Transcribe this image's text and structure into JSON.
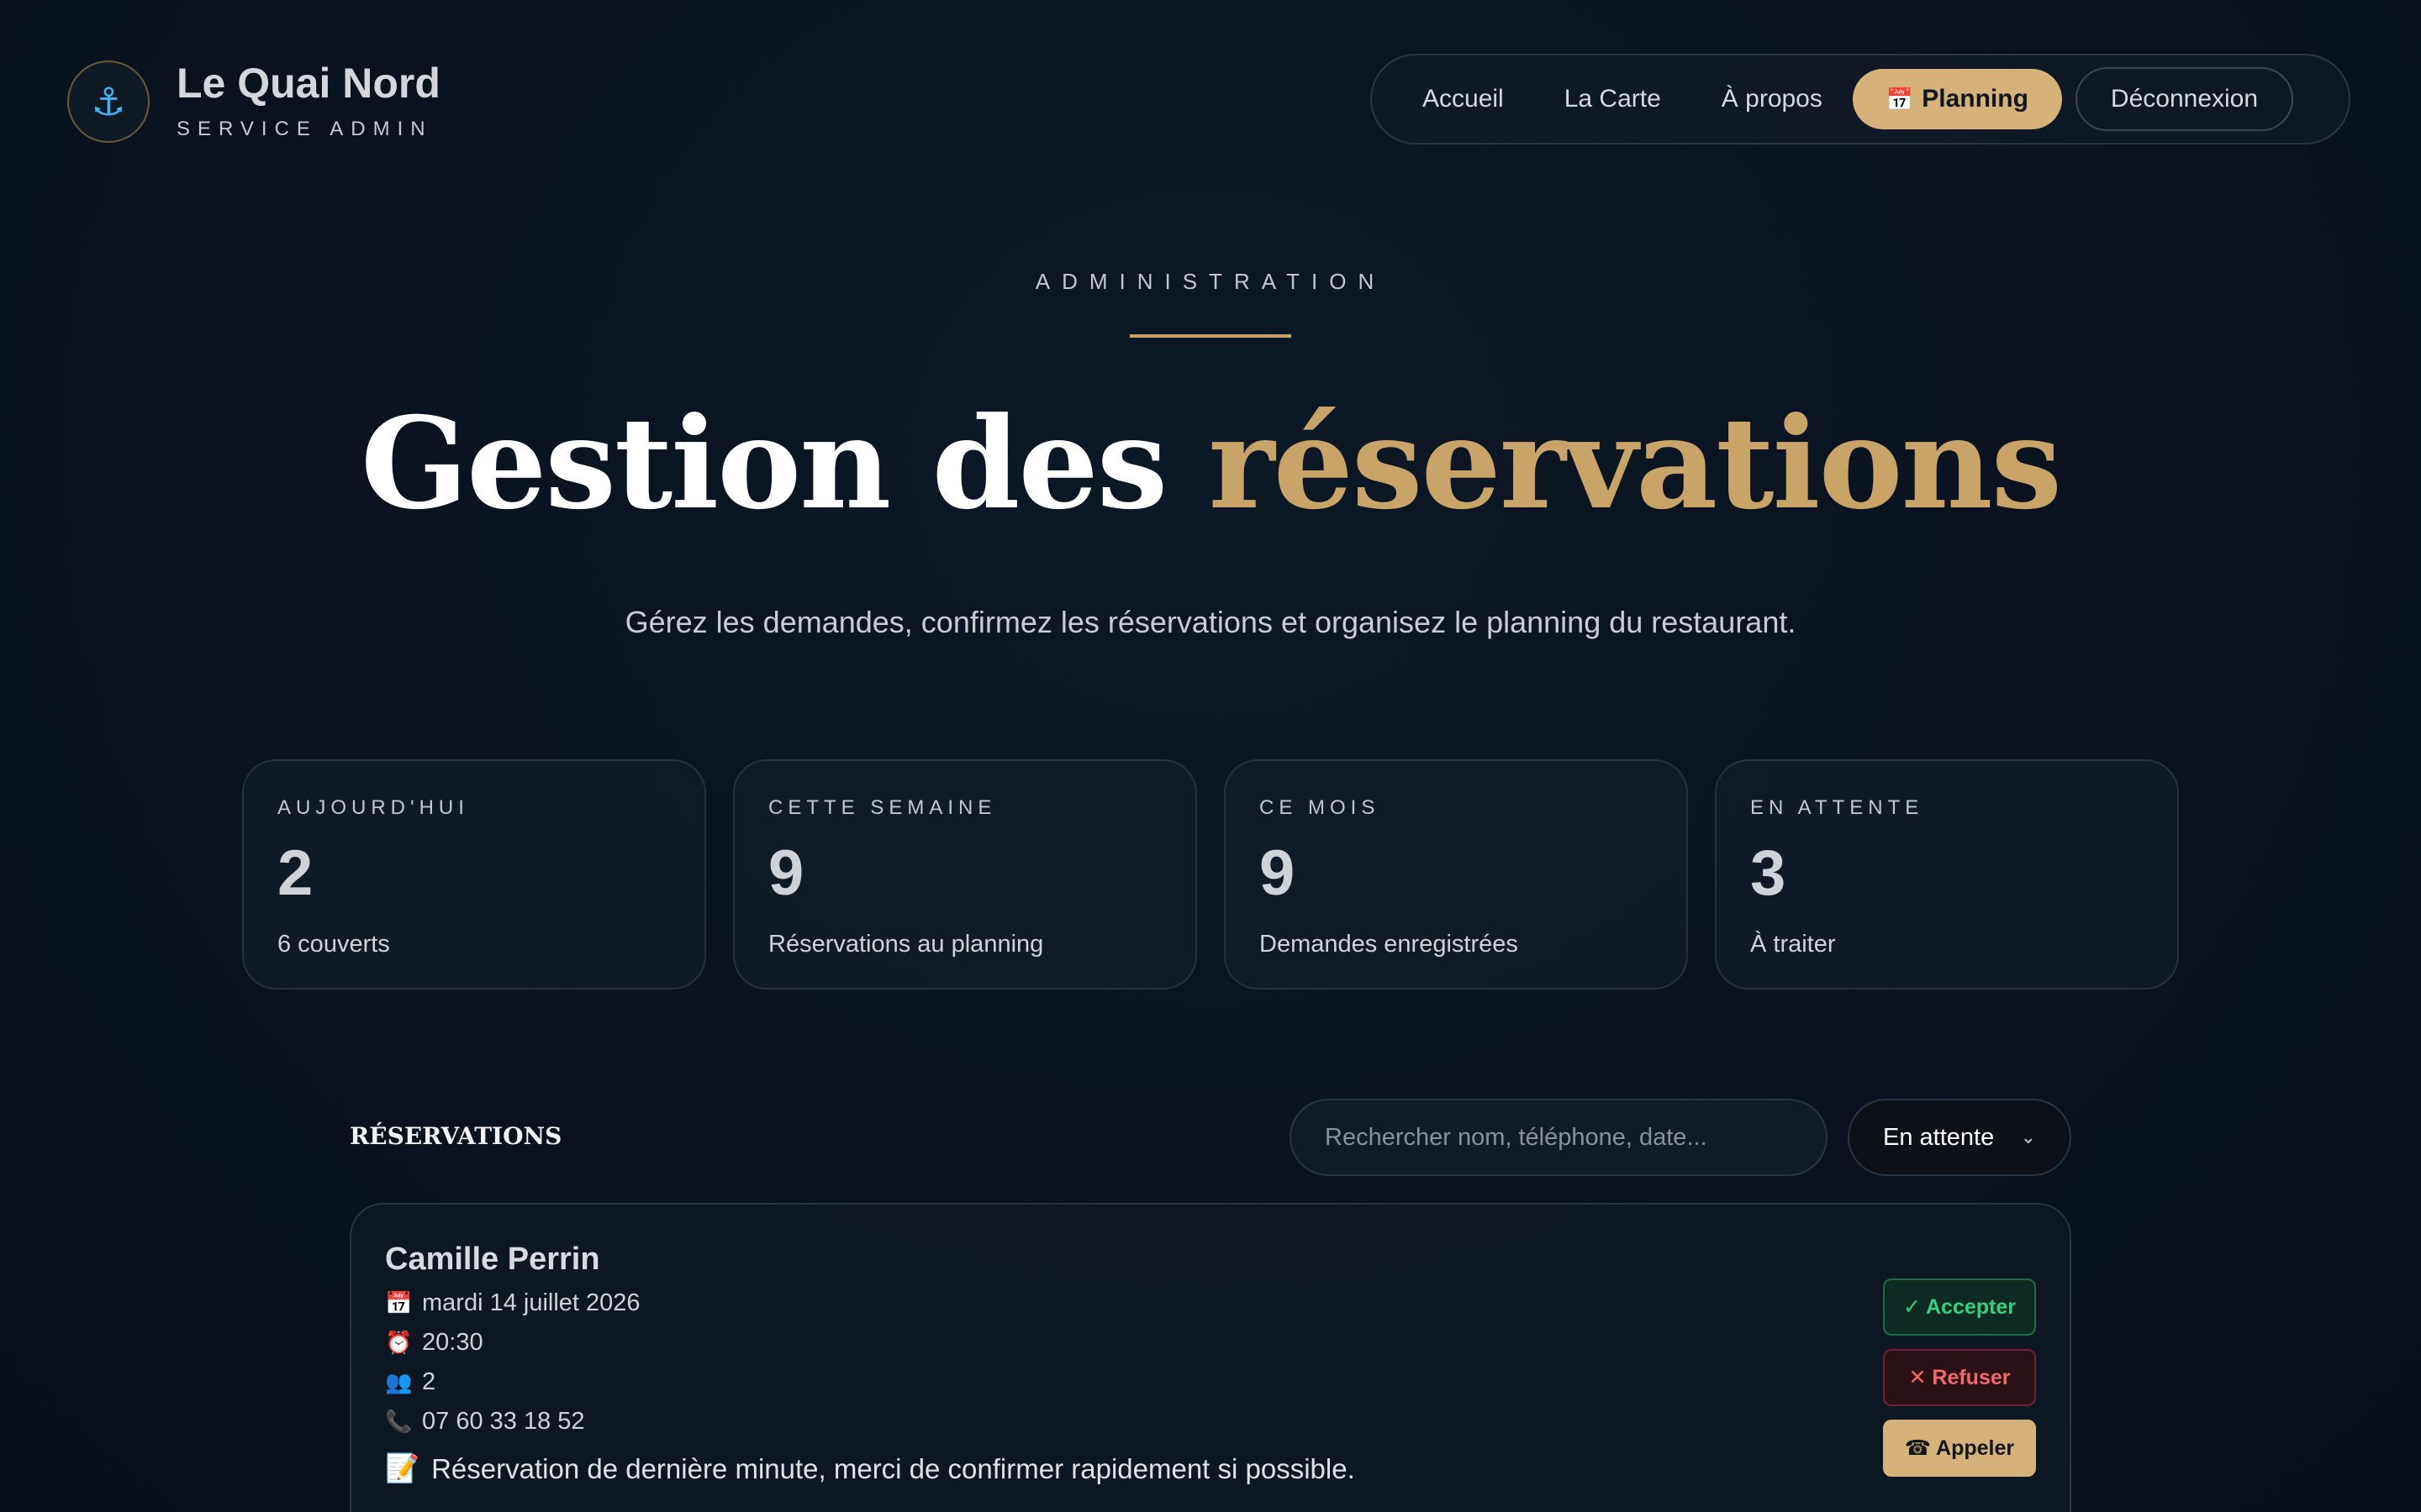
{
  "brand": {
    "name": "Le Quai Nord",
    "subtitle": "SERVICE ADMIN",
    "logo_icon": "anchor-icon"
  },
  "nav": {
    "items": [
      "Accueil",
      "La Carte",
      "À propos"
    ],
    "active": "Planning",
    "active_icon": "calendar-icon",
    "logout": "Déconnexion"
  },
  "hero": {
    "eyebrow": "ADMINISTRATION",
    "title_main": "Gestion des",
    "title_accent": "réservations",
    "subtitle": "Gérez les demandes, confirmez les réservations et organisez le planning du restaurant."
  },
  "stats": [
    {
      "label": "AUJOURD'HUI",
      "value": "2",
      "desc": "6 couverts"
    },
    {
      "label": "CETTE SEMAINE",
      "value": "9",
      "desc": "Réservations au planning"
    },
    {
      "label": "CE MOIS",
      "value": "9",
      "desc": "Demandes enregistrées"
    },
    {
      "label": "EN ATTENTE",
      "value": "3",
      "desc": "À traiter"
    }
  ],
  "reservations": {
    "title": "RÉSERVATIONS",
    "search_placeholder": "Rechercher nom, téléphone, date...",
    "filter_value": "En attente",
    "items": [
      {
        "name": "Camille Perrin",
        "date": "mardi 14 juillet 2026",
        "time": "20:30",
        "guests": "2",
        "phone": "07 60 33 18 52",
        "note": "Réservation de dernière minute, merci de confirmer rapidement si possible.",
        "accept_label": "✓ Accepter",
        "refuse_label": "✕ Refuser",
        "call_label": "☎ Appeler"
      }
    ]
  },
  "colors": {
    "accent": "#c9a468",
    "accept": "#35d07f",
    "refuse": "#f06a6a"
  }
}
